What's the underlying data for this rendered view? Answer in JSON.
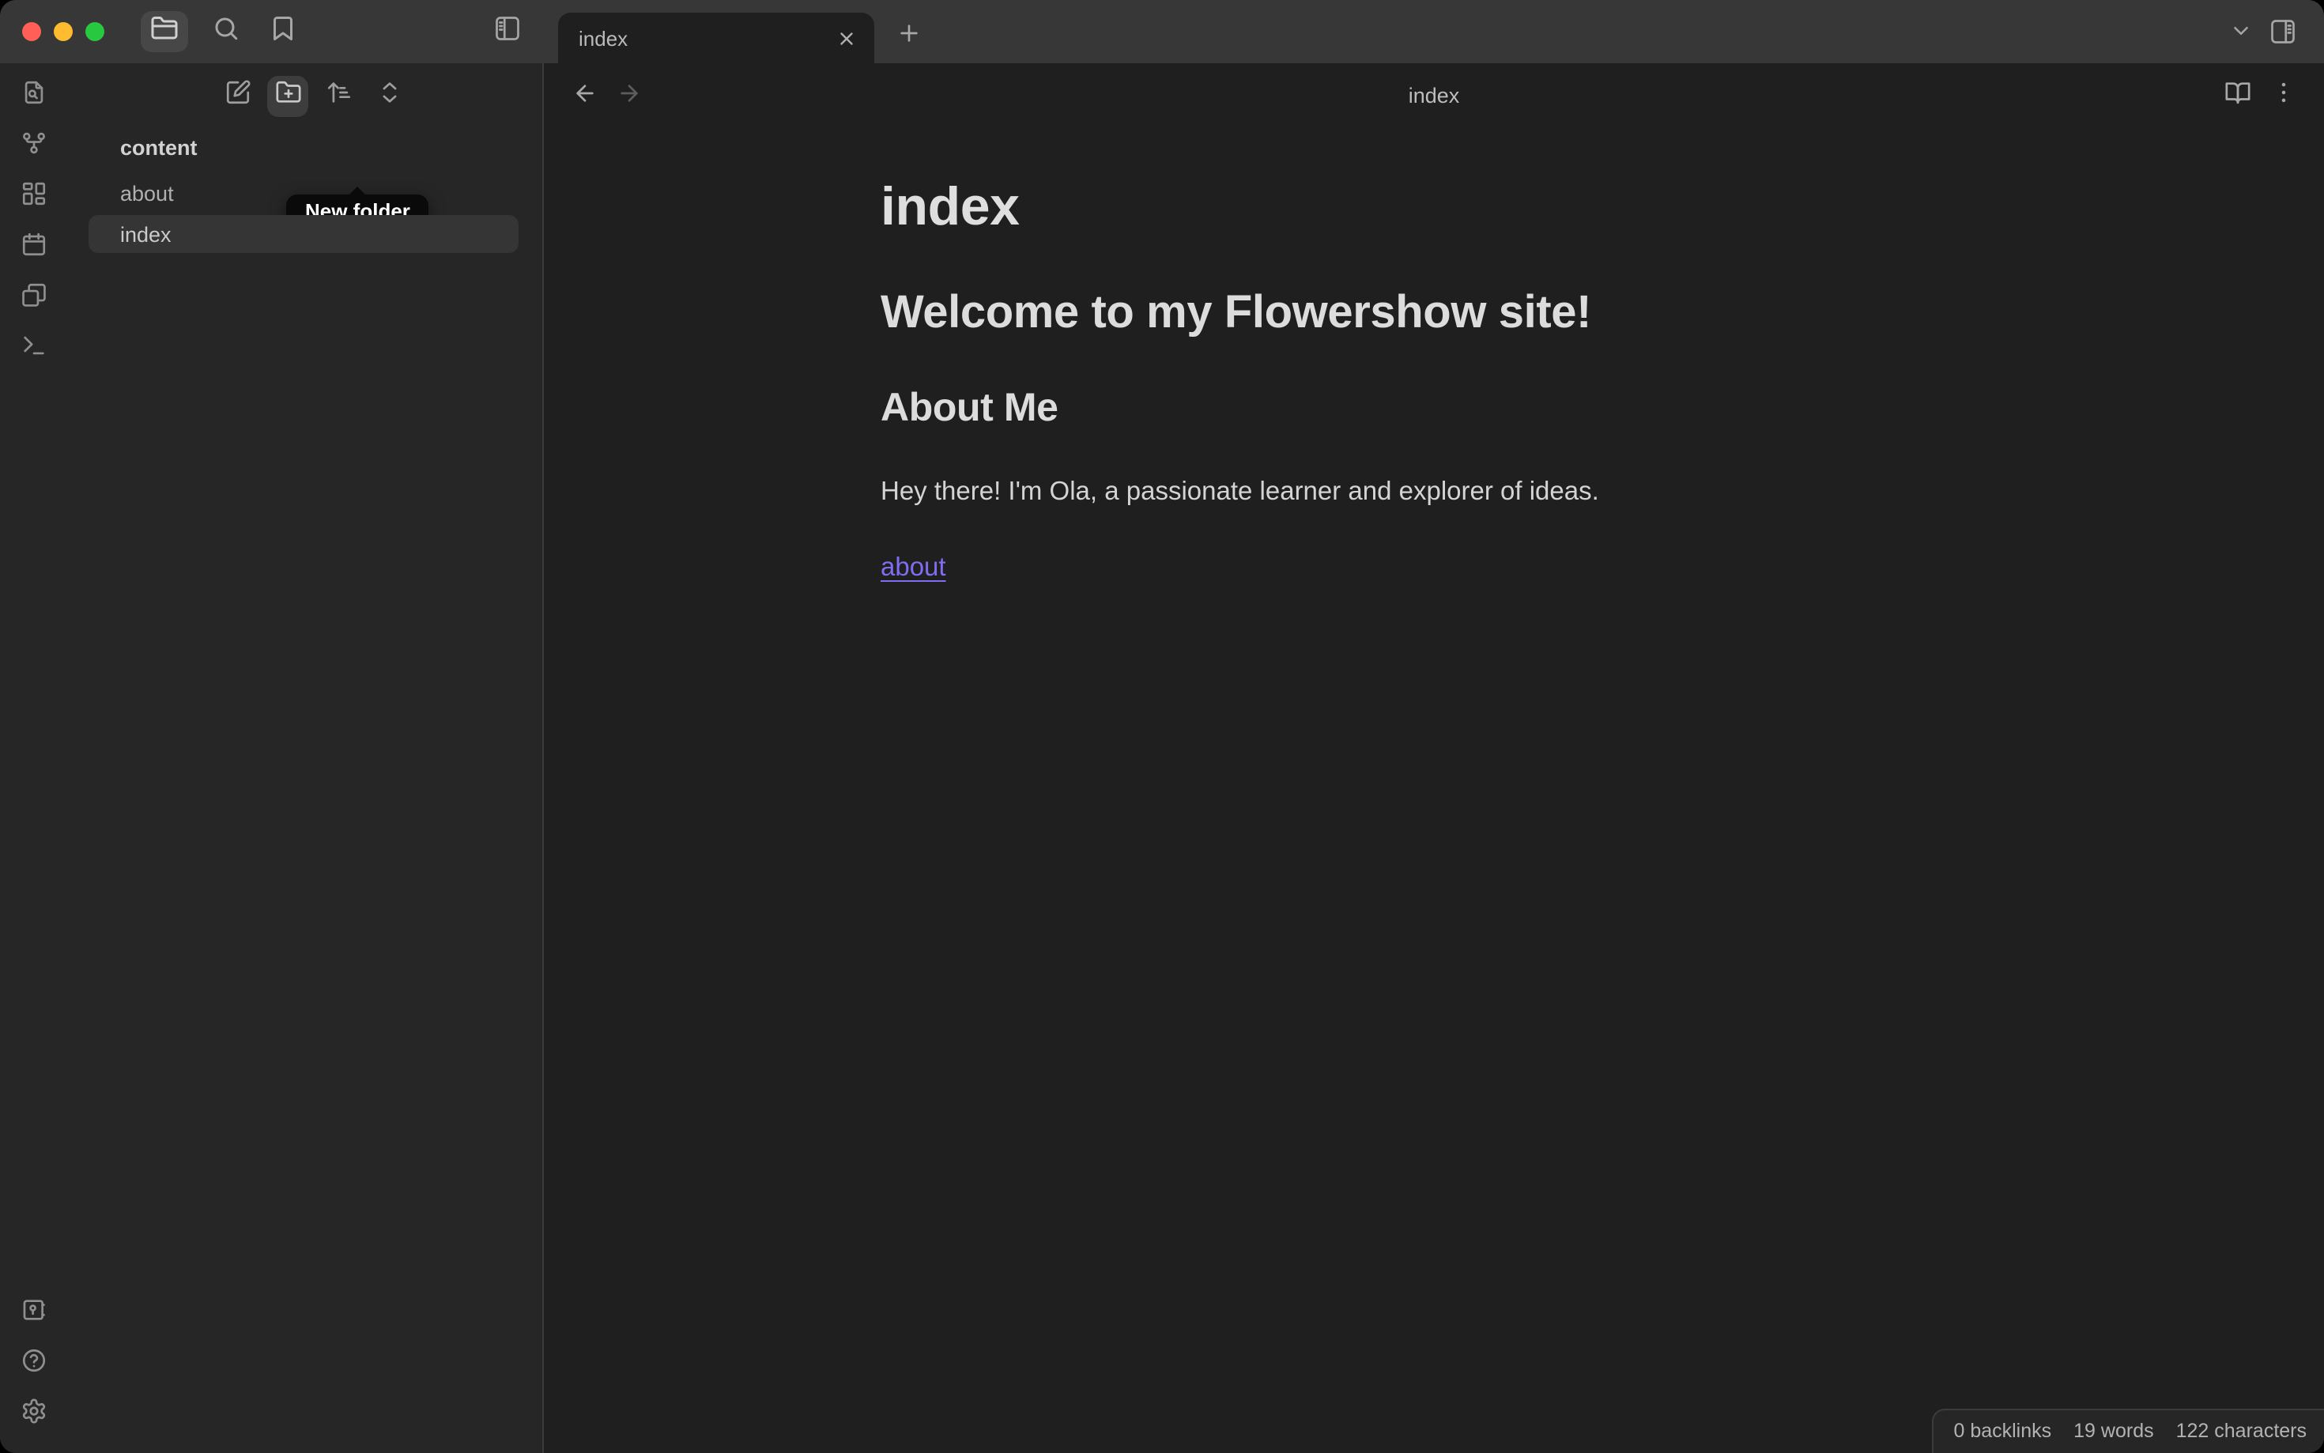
{
  "titlebar": {
    "icons": [
      "folder-icon",
      "search-icon",
      "bookmark-icon",
      "panel-left-toggle-icon"
    ],
    "right_icons": [
      "chevron-down-icon",
      "panel-right-toggle-icon"
    ]
  },
  "tabbar": {
    "active_tab": "index",
    "close_label": "close-tab",
    "new_tab_label": "new-tab"
  },
  "ribbon": {
    "top_icons": [
      "quick-switcher",
      "graph-view",
      "canvas-dashboard",
      "daily-note-calendar",
      "templates-copy",
      "terminal"
    ],
    "bottom_icons": [
      "open-vault",
      "help",
      "settings"
    ]
  },
  "explorer": {
    "toolbar": [
      {
        "name": "new-note"
      },
      {
        "name": "new-folder",
        "tooltip": "New folder"
      },
      {
        "name": "sort-order"
      },
      {
        "name": "expand-collapse"
      }
    ],
    "tooltip_text": "New folder",
    "vault_name": "content",
    "files": [
      {
        "name": "about",
        "selected": false
      },
      {
        "name": "index",
        "selected": true
      }
    ]
  },
  "pane": {
    "title": "index",
    "content": {
      "inline_title": "index",
      "h1": "Welcome to my Flowershow site!",
      "h2": "About Me",
      "paragraph": "Hey there! I'm Ola, a passionate learner and explorer of ideas.",
      "link": "about"
    }
  },
  "statusbar": {
    "items": [
      "0 backlinks",
      "19 words",
      "122 characters"
    ]
  },
  "colors": {
    "accent_link": "#7f6df2",
    "titlebar_bg": "#373737",
    "sidebar_bg": "#262626",
    "editor_bg": "#1f1f1f",
    "selection_bg": "#353535",
    "tooltip_bg": "#0a0a0a",
    "traffic_red": "#ff5f57",
    "traffic_yellow": "#febc2e",
    "traffic_green": "#28c840"
  }
}
